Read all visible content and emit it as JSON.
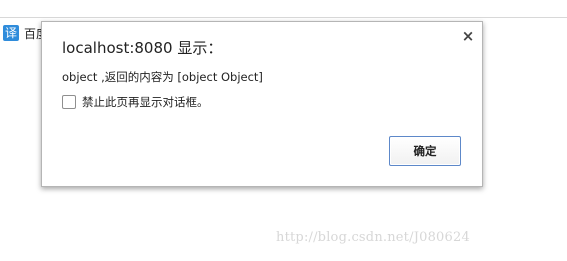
{
  "bookmark": {
    "icon_glyph": "译",
    "icon_name": "translate-icon",
    "label": "百度"
  },
  "dialog": {
    "title": "localhost:8080 显示：",
    "close_glyph": "×",
    "message": "object ,返回的内容为 [object Object]",
    "checkbox_label": "禁止此页再显示对话框。",
    "checkbox_checked": false,
    "ok_label": "确定"
  },
  "watermark": "http://blog.csdn.net/J080624",
  "colors": {
    "bookmark_icon": "#2f8cdb",
    "button_border": "#5d88c9"
  }
}
